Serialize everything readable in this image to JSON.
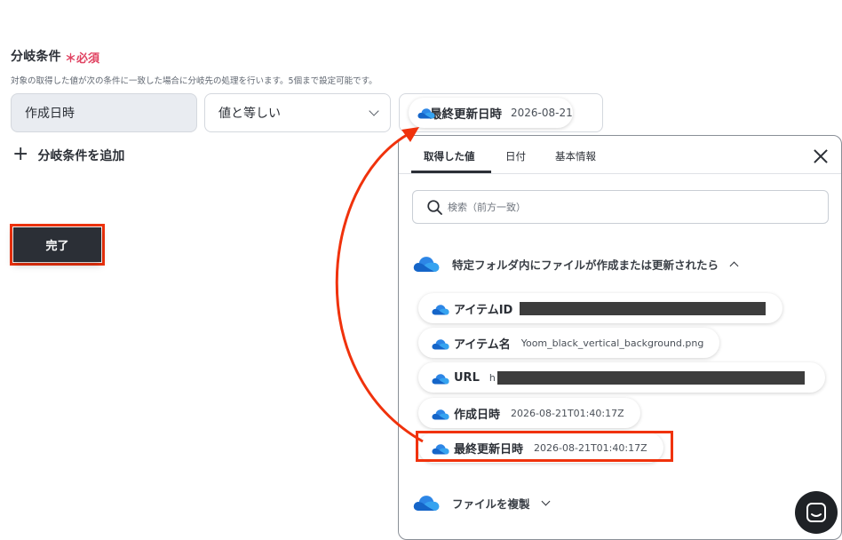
{
  "form": {
    "title": "分岐条件",
    "required_mark": "＊",
    "required_label": "必須",
    "description": "対象の取得した値が次の条件に一致した場合に分岐先の処理を行います。5個まで設定可能です。",
    "field_value": "作成日時",
    "operator_value": "値と等しい",
    "compare_chip": {
      "name": "最終更新日時",
      "value": "2026-08-21"
    },
    "add_condition_label": "分岐条件を追加",
    "done_label": "完了"
  },
  "panel": {
    "tabs": [
      {
        "label": "取得した値",
        "active": true
      },
      {
        "label": "日付",
        "active": false
      },
      {
        "label": "基本情報",
        "active": false
      }
    ],
    "search_placeholder": "検索（前方一致）",
    "groups": [
      {
        "label": "特定フォルダ内にファイルが作成または更新されたら",
        "expanded": true,
        "items": [
          {
            "name": "アイテムID",
            "value": ""
          },
          {
            "name": "アイテム名",
            "value": "Yoom_black_vertical_background.png"
          },
          {
            "name": "URL",
            "value": "h"
          },
          {
            "name": "作成日時",
            "value": "2026-08-21T01:40:17Z"
          },
          {
            "name": "最終更新日時",
            "value": "2026-08-21T01:40:17Z"
          }
        ]
      },
      {
        "label": "ファイルを複製",
        "expanded": false
      }
    ]
  },
  "colors": {
    "accent_red": "#f0320c",
    "required_pink": "#e04261",
    "cloud_blue": "#1e6fd6",
    "dark": "#2b2f36"
  },
  "icons": [
    "onedrive-cloud-icon",
    "search-icon",
    "close-icon",
    "chevron-down-icon",
    "chevron-up-icon",
    "plus-icon",
    "chat-icon"
  ]
}
